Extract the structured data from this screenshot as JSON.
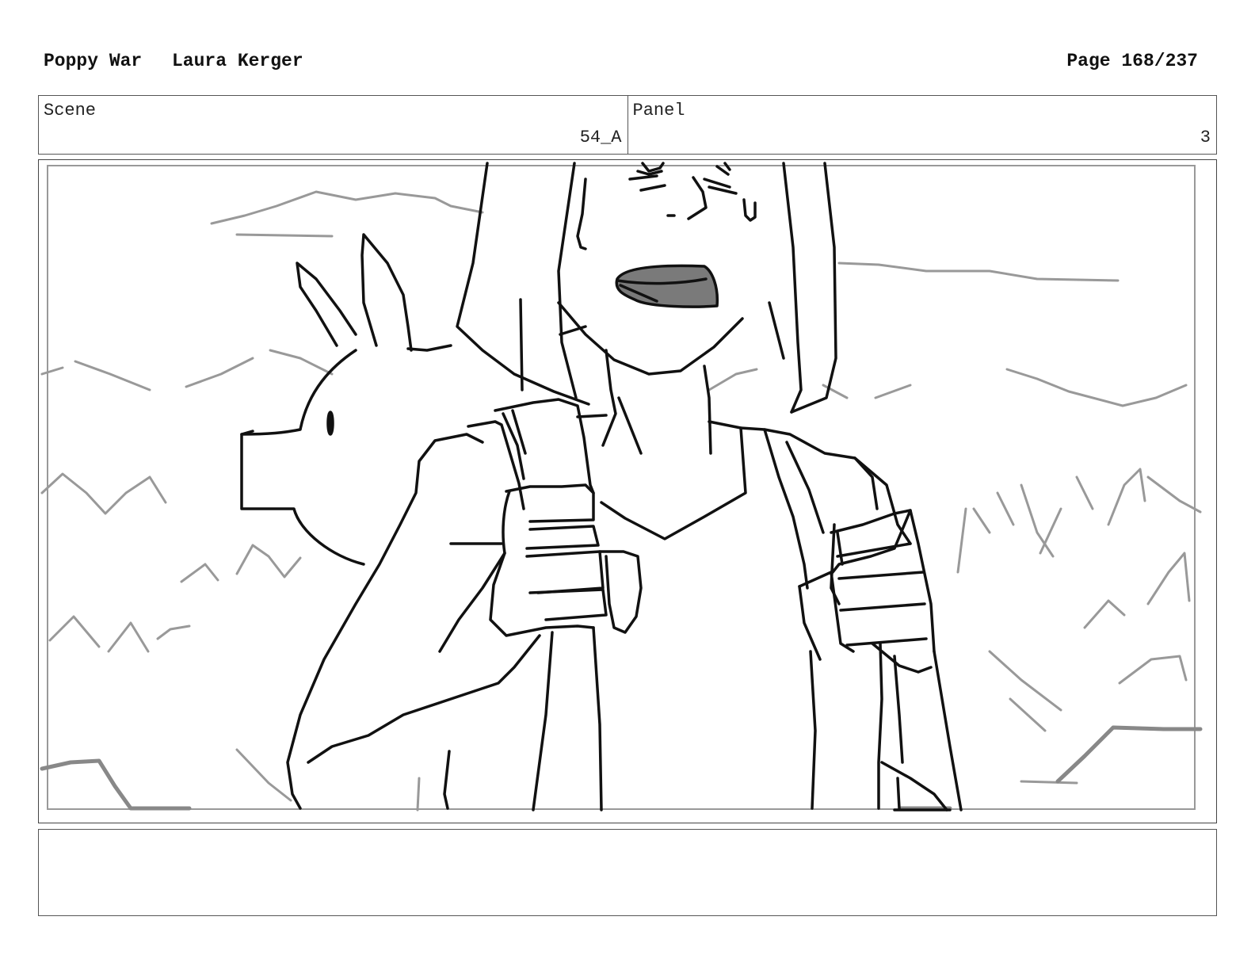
{
  "header": {
    "project": "Poppy War",
    "author": "Laura Kerger",
    "page_label": "Page 168/237"
  },
  "scene": {
    "label": "Scene",
    "value": "54_A"
  },
  "panel": {
    "label": "Panel",
    "value": "3"
  },
  "drawing": {
    "stroke_color": "#111111",
    "background_stroke_color": "#999999",
    "mouth_fill": "#7a7a7a"
  },
  "notes": {
    "text": ""
  }
}
